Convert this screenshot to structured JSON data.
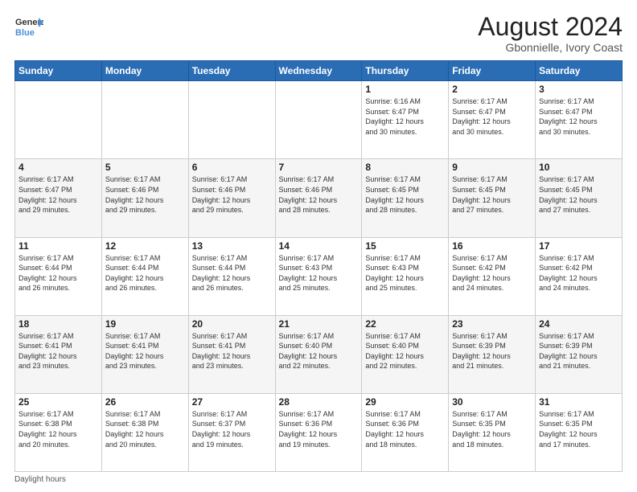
{
  "logo": {
    "line1": "General",
    "line2": "Blue"
  },
  "title": "August 2024",
  "location": "Gbonnielle, Ivory Coast",
  "weekdays": [
    "Sunday",
    "Monday",
    "Tuesday",
    "Wednesday",
    "Thursday",
    "Friday",
    "Saturday"
  ],
  "footer": "Daylight hours",
  "weeks": [
    [
      {
        "day": "",
        "info": ""
      },
      {
        "day": "",
        "info": ""
      },
      {
        "day": "",
        "info": ""
      },
      {
        "day": "",
        "info": ""
      },
      {
        "day": "1",
        "info": "Sunrise: 6:16 AM\nSunset: 6:47 PM\nDaylight: 12 hours\nand 30 minutes."
      },
      {
        "day": "2",
        "info": "Sunrise: 6:17 AM\nSunset: 6:47 PM\nDaylight: 12 hours\nand 30 minutes."
      },
      {
        "day": "3",
        "info": "Sunrise: 6:17 AM\nSunset: 6:47 PM\nDaylight: 12 hours\nand 30 minutes."
      }
    ],
    [
      {
        "day": "4",
        "info": "Sunrise: 6:17 AM\nSunset: 6:47 PM\nDaylight: 12 hours\nand 29 minutes."
      },
      {
        "day": "5",
        "info": "Sunrise: 6:17 AM\nSunset: 6:46 PM\nDaylight: 12 hours\nand 29 minutes."
      },
      {
        "day": "6",
        "info": "Sunrise: 6:17 AM\nSunset: 6:46 PM\nDaylight: 12 hours\nand 29 minutes."
      },
      {
        "day": "7",
        "info": "Sunrise: 6:17 AM\nSunset: 6:46 PM\nDaylight: 12 hours\nand 28 minutes."
      },
      {
        "day": "8",
        "info": "Sunrise: 6:17 AM\nSunset: 6:45 PM\nDaylight: 12 hours\nand 28 minutes."
      },
      {
        "day": "9",
        "info": "Sunrise: 6:17 AM\nSunset: 6:45 PM\nDaylight: 12 hours\nand 27 minutes."
      },
      {
        "day": "10",
        "info": "Sunrise: 6:17 AM\nSunset: 6:45 PM\nDaylight: 12 hours\nand 27 minutes."
      }
    ],
    [
      {
        "day": "11",
        "info": "Sunrise: 6:17 AM\nSunset: 6:44 PM\nDaylight: 12 hours\nand 26 minutes."
      },
      {
        "day": "12",
        "info": "Sunrise: 6:17 AM\nSunset: 6:44 PM\nDaylight: 12 hours\nand 26 minutes."
      },
      {
        "day": "13",
        "info": "Sunrise: 6:17 AM\nSunset: 6:44 PM\nDaylight: 12 hours\nand 26 minutes."
      },
      {
        "day": "14",
        "info": "Sunrise: 6:17 AM\nSunset: 6:43 PM\nDaylight: 12 hours\nand 25 minutes."
      },
      {
        "day": "15",
        "info": "Sunrise: 6:17 AM\nSunset: 6:43 PM\nDaylight: 12 hours\nand 25 minutes."
      },
      {
        "day": "16",
        "info": "Sunrise: 6:17 AM\nSunset: 6:42 PM\nDaylight: 12 hours\nand 24 minutes."
      },
      {
        "day": "17",
        "info": "Sunrise: 6:17 AM\nSunset: 6:42 PM\nDaylight: 12 hours\nand 24 minutes."
      }
    ],
    [
      {
        "day": "18",
        "info": "Sunrise: 6:17 AM\nSunset: 6:41 PM\nDaylight: 12 hours\nand 23 minutes."
      },
      {
        "day": "19",
        "info": "Sunrise: 6:17 AM\nSunset: 6:41 PM\nDaylight: 12 hours\nand 23 minutes."
      },
      {
        "day": "20",
        "info": "Sunrise: 6:17 AM\nSunset: 6:41 PM\nDaylight: 12 hours\nand 23 minutes."
      },
      {
        "day": "21",
        "info": "Sunrise: 6:17 AM\nSunset: 6:40 PM\nDaylight: 12 hours\nand 22 minutes."
      },
      {
        "day": "22",
        "info": "Sunrise: 6:17 AM\nSunset: 6:40 PM\nDaylight: 12 hours\nand 22 minutes."
      },
      {
        "day": "23",
        "info": "Sunrise: 6:17 AM\nSunset: 6:39 PM\nDaylight: 12 hours\nand 21 minutes."
      },
      {
        "day": "24",
        "info": "Sunrise: 6:17 AM\nSunset: 6:39 PM\nDaylight: 12 hours\nand 21 minutes."
      }
    ],
    [
      {
        "day": "25",
        "info": "Sunrise: 6:17 AM\nSunset: 6:38 PM\nDaylight: 12 hours\nand 20 minutes."
      },
      {
        "day": "26",
        "info": "Sunrise: 6:17 AM\nSunset: 6:38 PM\nDaylight: 12 hours\nand 20 minutes."
      },
      {
        "day": "27",
        "info": "Sunrise: 6:17 AM\nSunset: 6:37 PM\nDaylight: 12 hours\nand 19 minutes."
      },
      {
        "day": "28",
        "info": "Sunrise: 6:17 AM\nSunset: 6:36 PM\nDaylight: 12 hours\nand 19 minutes."
      },
      {
        "day": "29",
        "info": "Sunrise: 6:17 AM\nSunset: 6:36 PM\nDaylight: 12 hours\nand 18 minutes."
      },
      {
        "day": "30",
        "info": "Sunrise: 6:17 AM\nSunset: 6:35 PM\nDaylight: 12 hours\nand 18 minutes."
      },
      {
        "day": "31",
        "info": "Sunrise: 6:17 AM\nSunset: 6:35 PM\nDaylight: 12 hours\nand 17 minutes."
      }
    ]
  ]
}
